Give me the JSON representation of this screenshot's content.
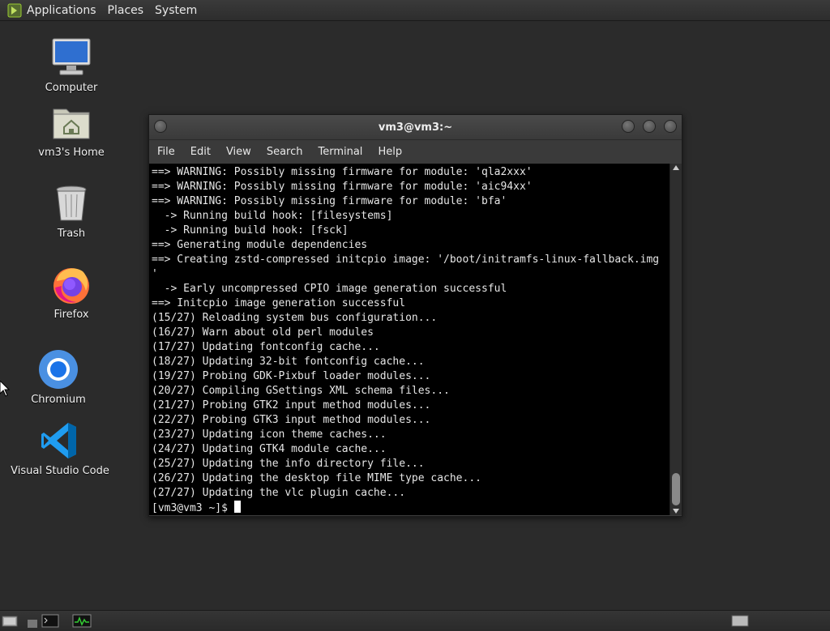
{
  "top_panel": {
    "menus": [
      "Applications",
      "Places",
      "System"
    ]
  },
  "desktop": {
    "icons": [
      {
        "label": "Computer",
        "icon": "computer-icon"
      },
      {
        "label": "vm3's Home",
        "icon": "home-folder-icon"
      },
      {
        "label": "Trash",
        "icon": "trash-icon"
      },
      {
        "label": "Firefox",
        "icon": "firefox-icon"
      },
      {
        "label": "Chromium",
        "icon": "chromium-icon"
      },
      {
        "label": "Visual Studio Code",
        "icon": "vscode-icon"
      }
    ]
  },
  "terminal": {
    "title": "vm3@vm3:~",
    "menu": [
      "File",
      "Edit",
      "View",
      "Search",
      "Terminal",
      "Help"
    ],
    "lines": [
      "==> WARNING: Possibly missing firmware for module: 'qla2xxx'",
      "==> WARNING: Possibly missing firmware for module: 'aic94xx'",
      "==> WARNING: Possibly missing firmware for module: 'bfa'",
      "  -> Running build hook: [filesystems]",
      "  -> Running build hook: [fsck]",
      "==> Generating module dependencies",
      "==> Creating zstd-compressed initcpio image: '/boot/initramfs-linux-fallback.img",
      "'",
      "  -> Early uncompressed CPIO image generation successful",
      "==> Initcpio image generation successful",
      "(15/27) Reloading system bus configuration...",
      "(16/27) Warn about old perl modules",
      "(17/27) Updating fontconfig cache...",
      "(18/27) Updating 32-bit fontconfig cache...",
      "(19/27) Probing GDK-Pixbuf loader modules...",
      "(20/27) Compiling GSettings XML schema files...",
      "(21/27) Probing GTK2 input method modules...",
      "(22/27) Probing GTK3 input method modules...",
      "(23/27) Updating icon theme caches...",
      "(24/27) Updating GTK4 module cache...",
      "(25/27) Updating the info directory file...",
      "(26/27) Updating the desktop file MIME type cache...",
      "(27/27) Updating the vlc plugin cache..."
    ],
    "prompt": "[vm3@vm3 ~]$ "
  },
  "bottom_panel": {
    "items": [
      "show-desktop-icon",
      "terminal-launcher-icon",
      "system-monitor-icon",
      "workspace-switcher"
    ]
  },
  "colors": {
    "desktop_bg": "#2b2b2b",
    "terminal_bg": "#000000",
    "terminal_fg": "#e6e6e6",
    "firefox_orange": "#ff7139",
    "vscode_blue": "#1f9cf0",
    "chromium_blue": "#4a90e2"
  }
}
